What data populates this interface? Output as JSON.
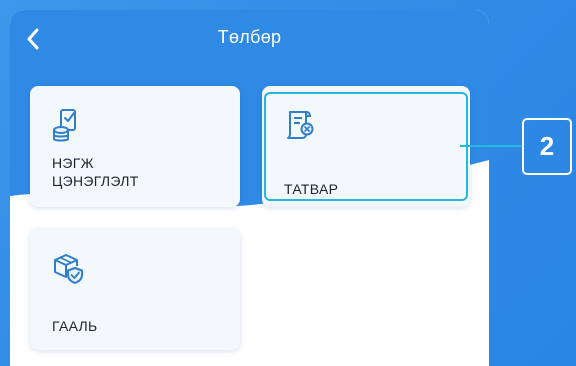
{
  "header": {
    "title": "Төлбөр",
    "back_icon": "chevron-left-icon"
  },
  "cards": [
    {
      "label": "НЭГЖ\nЦЭНЭГЛЭЛТ",
      "icon": "coins-check-icon"
    },
    {
      "label": "ТАТВАР",
      "icon": "tax-document-icon"
    },
    {
      "label": "ГААЛЬ",
      "icon": "customs-box-shield-icon"
    }
  ],
  "annotation": {
    "step_number": "2"
  },
  "colors": {
    "primary_blue": "#2f8ae6",
    "highlight_cyan": "#25b7dd",
    "card_background": "#f3f8fd"
  }
}
